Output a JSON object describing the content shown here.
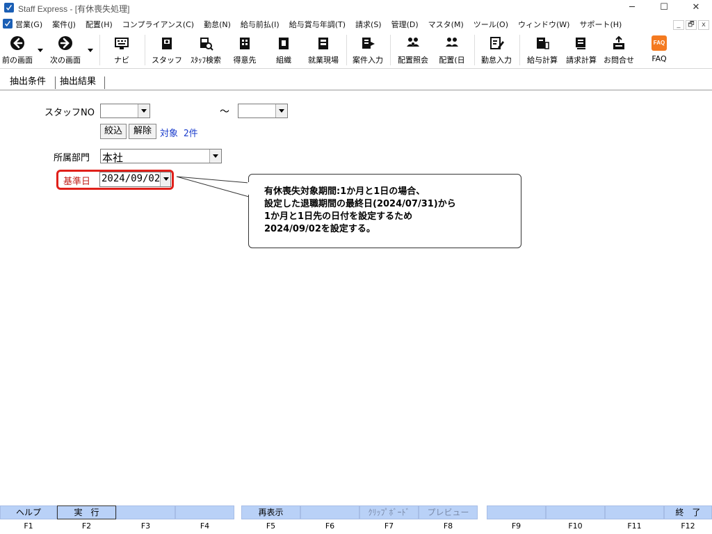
{
  "window": {
    "title": "Staff Express - [有休喪失処理]",
    "minimize": "─",
    "maximize": "☐",
    "close": "✕"
  },
  "menu": {
    "items": [
      "営業(G)",
      "案件(J)",
      "配置(H)",
      "コンプライアンス(C)",
      "勤怠(N)",
      "給与前払(I)",
      "給与賞与年調(T)",
      "請求(S)",
      "管理(D)",
      "マスタ(M)",
      "ツール(O)",
      "ウィンドウ(W)",
      "サポート(H)"
    ],
    "mdi_min": "_",
    "mdi_restore": "🗗",
    "mdi_close": "x"
  },
  "toolbar": {
    "back": "前の画面",
    "forward": "次の画面",
    "navi": "ナビ",
    "staff": "スタッフ",
    "staff_search": "ｽﾀｯﾌ検索",
    "client": "得意先",
    "org": "組織",
    "worksite": "就業現場",
    "case_entry": "案件入力",
    "placement_ref": "配置照会",
    "placement_day": "配置(日",
    "attendance": "勤怠入力",
    "payroll": "給与計算",
    "billing": "請求計算",
    "inquiry": "お問合せ",
    "faq": "FAQ",
    "faq_icon_text": "FAQ"
  },
  "tabs": {
    "conditions": "抽出条件",
    "results": "抽出結果"
  },
  "form": {
    "staff_no_label": "スタッフNO",
    "staff_no_from": "",
    "staff_no_to": "",
    "tilde": "～",
    "filter_button": "絞込",
    "clear_button": "解除",
    "target_count": "対象 2件",
    "dept_label": "所属部門",
    "dept_value": "本社",
    "base_date_label": "基準日",
    "base_date_value": "2024/09/02"
  },
  "callout": {
    "text": "有休喪失対象期間:1か月と1日の場合、\n設定した退職期間の最終日(2024/07/31)から\n1か月と1日先の日付を設定するため\n2024/09/02を設定する。"
  },
  "function_keys": [
    {
      "label": "ヘルプ",
      "key": "F1"
    },
    {
      "label": "実　行",
      "key": "F2"
    },
    {
      "label": "",
      "key": "F3"
    },
    {
      "label": "",
      "key": "F4"
    },
    {
      "label": "再表示",
      "key": "F5"
    },
    {
      "label": "",
      "key": "F6"
    },
    {
      "label": "ｸﾘｯﾌﾟﾎﾞｰﾄﾞ",
      "key": "F7"
    },
    {
      "label": "プレビュー",
      "key": "F8"
    },
    {
      "label": "",
      "key": "F9"
    },
    {
      "label": "",
      "key": "F10"
    },
    {
      "label": "",
      "key": "F11"
    },
    {
      "label": "終　了",
      "key": "F12"
    }
  ],
  "colors": {
    "highlight": "#e0201a",
    "fkey_bg": "#b9d1f7",
    "link_blue": "#1a3ccc"
  }
}
